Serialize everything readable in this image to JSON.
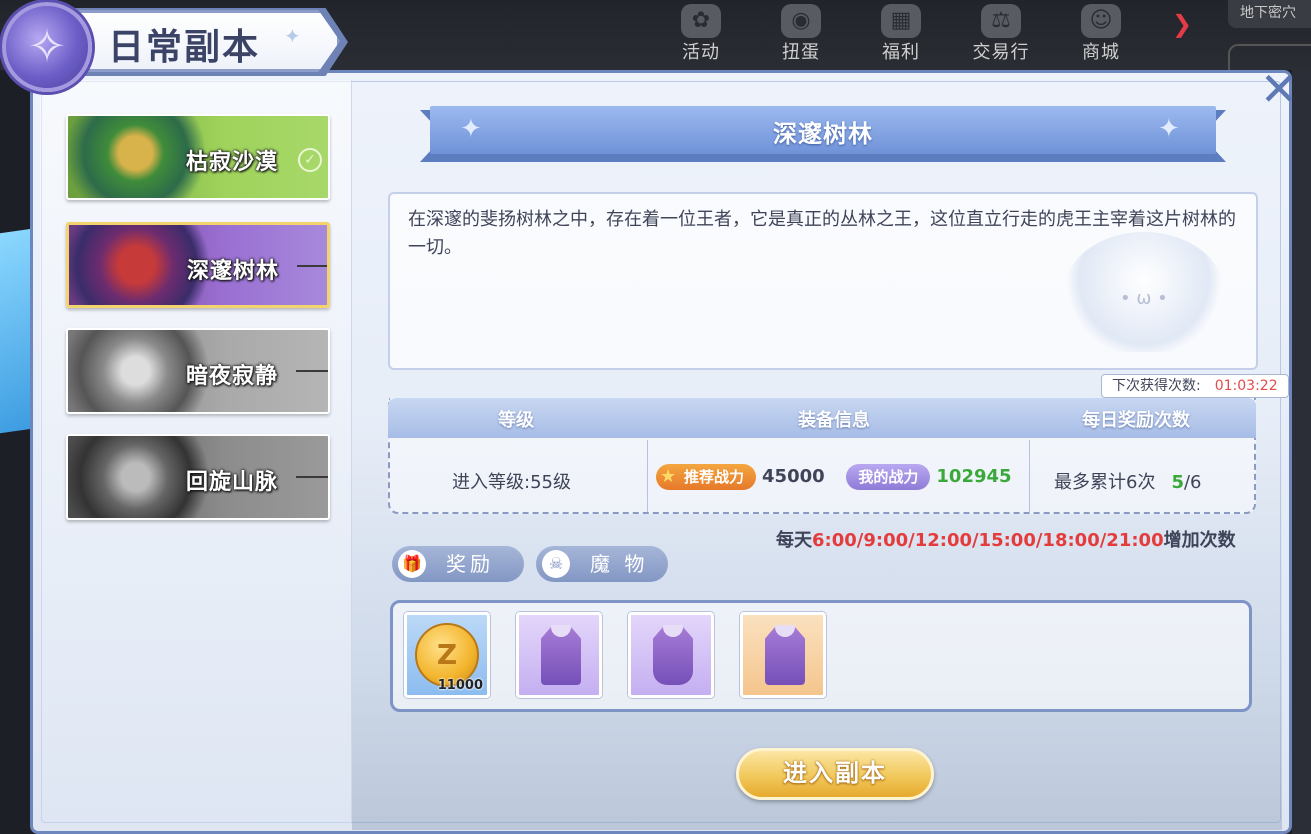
{
  "topbar": {
    "items": [
      {
        "label": "活动",
        "icon": "activity-icon"
      },
      {
        "label": "扭蛋",
        "icon": "gacha-icon"
      },
      {
        "label": "福利",
        "icon": "gift-icon"
      },
      {
        "label": "交易行",
        "icon": "scales-icon"
      },
      {
        "label": "商城",
        "icon": "shop-icon"
      }
    ],
    "right_tag": "地下密穴"
  },
  "window": {
    "title": "日常副本"
  },
  "dungeons": [
    {
      "name": "枯寂沙漠",
      "status": "cleared"
    },
    {
      "name": "深邃树林",
      "status": "selected"
    },
    {
      "name": "暗夜寂静",
      "status": "locked"
    },
    {
      "name": "回旋山脉",
      "status": "locked"
    }
  ],
  "detail": {
    "title": "深邃树林",
    "description": "在深邃的斐扬树林之中，存在着一位王者，它是真正的丛林之王，这位直立行走的虎王主宰着这片树林的一切。",
    "timer_label": "下次获得次数:",
    "timer_value": "01:03:22",
    "table": {
      "headers": [
        "等级",
        "装备信息",
        "每日奖励次数"
      ],
      "entry_level": "进入等级:55级",
      "recommended_label": "推荐战力",
      "recommended_value": "45000",
      "my_power_label": "我的战力",
      "my_power_value": "102945",
      "max_label": "最多累计6次",
      "count_current": "5",
      "count_total": "/6"
    },
    "schedule": {
      "prefix": "每天",
      "times": "6:00/9:00/12:00/15:00/18:00/21:00",
      "suffix": "增加次数"
    },
    "tabs": [
      {
        "label": "奖励",
        "icon": "gift-icon"
      },
      {
        "label": "魔 物",
        "icon": "monster-skull-icon"
      }
    ],
    "rewards": [
      {
        "type": "coin",
        "quantity": "11000",
        "icon": "zeny-coin-icon"
      },
      {
        "type": "robe",
        "quantity": "",
        "icon": "purple-robe-icon"
      },
      {
        "type": "coat",
        "quantity": "",
        "icon": "purple-coat-icon"
      },
      {
        "type": "robe",
        "quantity": "",
        "icon": "purple-robe-icon"
      }
    ],
    "enter_button": "进入副本"
  },
  "colors": {
    "accent": "#6f92d8",
    "highlight_red": "#e43c3c",
    "count_green": "#3aa93a",
    "button_gold": "#f1c85b"
  }
}
